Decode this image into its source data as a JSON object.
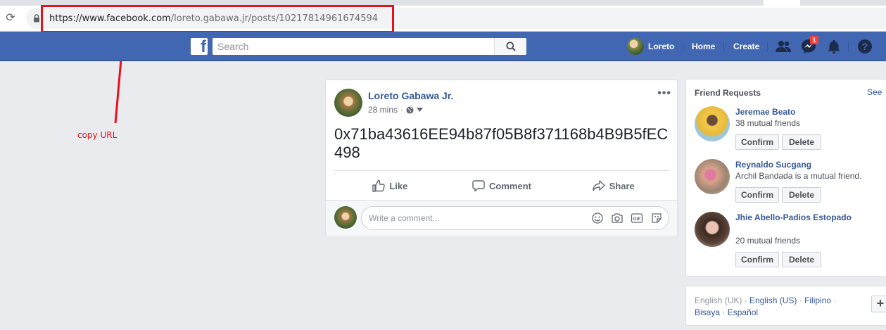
{
  "browser": {
    "url_base": "https://www.facebook.com",
    "url_path": "/loreto.gabawa.jr/posts/10217814961674594",
    "reload_icon": "reload-icon",
    "lock_icon": "lock-icon"
  },
  "annotation": {
    "note": "copy URL",
    "color": "#e8101c"
  },
  "topbar": {
    "logo_letter": "f",
    "search_placeholder": "Search",
    "user_name": "Loreto",
    "home": "Home",
    "create": "Create",
    "messages_badge": "1",
    "brand_color": "#4267b2"
  },
  "post": {
    "author": "Loreto Gabawa Jr.",
    "time": "28 mins",
    "more": "•••",
    "text": "0x71ba43616EE94b87f05B8f371168b4B9B5fEC498",
    "actions": {
      "like": "Like",
      "comment": "Comment",
      "share": "Share"
    },
    "comment_placeholder": "Write a comment..."
  },
  "friend_requests": {
    "title": "Friend Requests",
    "see_all": "See",
    "confirm": "Confirm",
    "delete": "Delete",
    "items": [
      {
        "name": "Jeremae Beato",
        "mutual": "38 mutual friends"
      },
      {
        "name": "Reynaldo Sucgang",
        "mutual": "Archil Bandada is a mutual friend."
      },
      {
        "name": "Jhie Abello-Padios Estopado",
        "mutual": "20 mutual friends"
      }
    ]
  },
  "languages": {
    "current": "English (UK)",
    "sep": " · ",
    "items": [
      "English (US)",
      "Filipino",
      "Bisaya",
      "Español"
    ],
    "more": "+"
  }
}
